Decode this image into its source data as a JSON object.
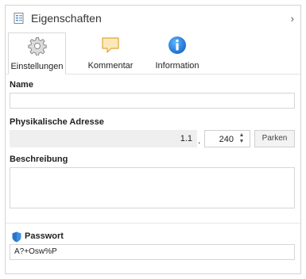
{
  "panel": {
    "title": "Eigenschaften",
    "collapse_glyph": "›"
  },
  "tabs": [
    {
      "label": "Einstellungen",
      "icon": "gear-icon",
      "active": true
    },
    {
      "label": "Kommentar",
      "icon": "comment-icon",
      "active": false
    },
    {
      "label": "Information",
      "icon": "info-icon",
      "active": false
    }
  ],
  "fields": {
    "name_label": "Name",
    "name_value": "",
    "address_label": "Physikalische Adresse",
    "address_prefix": "1.1",
    "address_separator": ".",
    "address_device": "240",
    "park_button": "Parken",
    "description_label": "Beschreibung",
    "description_value": "",
    "password_label": "Passwort",
    "password_value": "A?+Osw%P"
  },
  "colors": {
    "accent": "#1e88e5",
    "comment_fill": "#fde9b8",
    "comment_stroke": "#e0a43a",
    "shield": "#3a8ee6"
  }
}
